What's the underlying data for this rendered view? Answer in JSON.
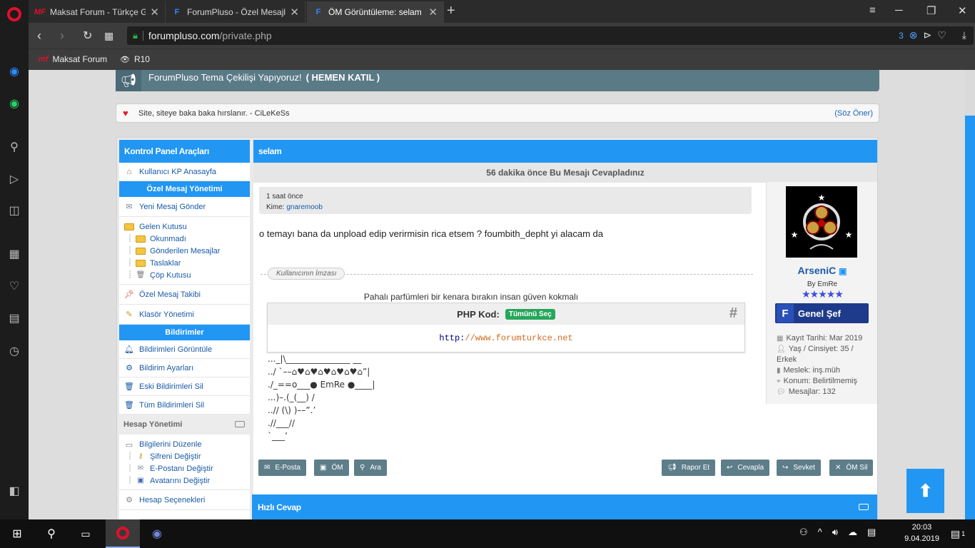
{
  "browser": {
    "tabs": [
      {
        "title": "Maksat Forum - Türkçe Ge",
        "favicon": "MF"
      },
      {
        "title": "ForumPluso - Özel Mesajla",
        "favicon": "F"
      },
      {
        "title": "ÖM Görüntüleme: selam",
        "favicon": "F"
      }
    ],
    "url_host": "forumpluso.com",
    "url_path": "/private.php",
    "blocked_count": "3",
    "bookmarks": [
      {
        "label": "Maksat Forum",
        "favicon": "mf"
      },
      {
        "label": "R10",
        "favicon": "R10"
      }
    ]
  },
  "announcement": {
    "text": "ForumPluso Tema Çekilişi Yapıyoruz!",
    "link": "( HEMEN KATIL )"
  },
  "quote_bar": {
    "text": "Site, siteye baka baka hırslanır. - CiLeKeSs",
    "link": "(Söz Öner)"
  },
  "left_panel": {
    "title": "Kontrol Panel Araçları",
    "home": "Kullanıcı KP Anasayfa",
    "pm_section": "Özel Mesaj Yönetimi",
    "new_message": "Yeni Mesaj Gönder",
    "inbox": "Gelen Kutusu",
    "folders": [
      "Okunmadı",
      "Gönderilen Mesajlar",
      "Taslaklar",
      "Çöp Kutusu"
    ],
    "tracking": "Özel Mesaj Takibi",
    "folder_mgmt": "Klasör Yönetimi",
    "notif_section": "Bildirimler",
    "notif_items": [
      "Bildirimleri Görüntüle",
      "Bildirim Ayarları",
      "Eski Bildirimleri Sil",
      "Tüm Bildirimleri Sil"
    ],
    "account_section": "Hesap Yönetimi",
    "edit_details": "Bilgilerini Düzenle",
    "account_children": [
      "Şifreni Değiştir",
      "E-Postanı Değiştir",
      "Avatarını Değiştir"
    ],
    "account_options": "Hesap Seçenekleri"
  },
  "message": {
    "title": "selam",
    "reply_info": "56 dakika önce Bu Mesajı Cevapladınız",
    "time": "1 saat önce",
    "to_label": "Kime:",
    "to_user": "gnaremoob",
    "body": "o temayı bana da unpload edip verirmisin rica etsem ? foumbith_depht yi alacam da",
    "signature_label": "Kullanıcının İmzası",
    "signature_text": "Pahalı parfümleri bir kenara bırakın insan güven kokmalı",
    "code_title": "PHP Kod:",
    "code_select": "Tümünü Seç",
    "code_hash": "#",
    "code_keyword": "http:",
    "code_string": "//www.forumturkce.net",
    "ascii": [
      "..._|\\_______________ __",
      "../ `––⌂♥⌂♥⌂♥⌂♥⌂♥⌂”|",
      "./_==o___● EmRe ●____|",
      "...)–.(_(__) /",
      "..// (\\) )––”.’",
      ".//___//",
      "`___’"
    ]
  },
  "user": {
    "name": "ArseniC",
    "title": "By EmRe",
    "stars": "★★★★★",
    "rank": "Genel Şef",
    "details": [
      "Kayıt Tarihi: Mar 2019",
      "Yaş / Cinsiyet: 35 / Erkek",
      "Meslek: inş.müh",
      "Konum: Belirtilmemiş",
      "Mesajlar: 132"
    ]
  },
  "buttons": {
    "email": "E-Posta",
    "pm": "ÖM",
    "search": "Ara",
    "report": "Rapor Et",
    "reply": "Cevapla",
    "forward": "Sevket",
    "delete": "ÖM Sil"
  },
  "quick_reply": "Hızlı Cevap",
  "taskbar": {
    "time": "20:03",
    "date": "9.04.2019",
    "notif_count": "1"
  },
  "colors": {
    "accent": "#2196f3",
    "announce": "#5a7a86",
    "button": "#5d7d89",
    "link": "#1a5aa8"
  }
}
